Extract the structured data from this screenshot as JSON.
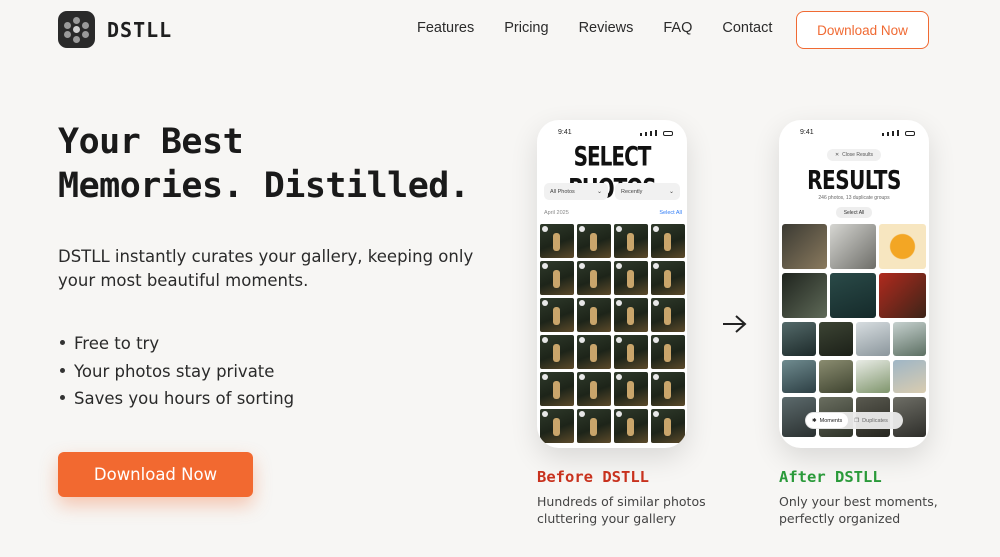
{
  "brand": {
    "name": "DSTLL"
  },
  "nav": {
    "links": [
      "Features",
      "Pricing",
      "Reviews",
      "FAQ",
      "Contact"
    ],
    "cta": "Download Now"
  },
  "hero": {
    "title_line1": "Your Best",
    "title_line2": "Memories. Distilled.",
    "description": "DSTLL instantly curates your gallery, keeping only your most beautiful moments.",
    "bullets": [
      "Free to try",
      "Your photos stay private",
      "Saves you hours of sorting"
    ],
    "cta": "Download Now"
  },
  "before_phone": {
    "time": "9:41",
    "title": "SELECT PHOTOS",
    "filter1": "All Photos",
    "filter2": "Recently",
    "section_date": "April 2025",
    "select_all": "Select All"
  },
  "after_phone": {
    "time": "9:41",
    "close_label": "Close Results",
    "title": "RESULTS",
    "subtitle": "246 photos, 13 duplicate groups",
    "select_all": "Select All",
    "tab_moments": "Moments",
    "tab_duplicates": "Duplicates"
  },
  "before_caption": {
    "title": "Before DSTLL",
    "desc": "Hundreds of similar photos cluttering your gallery",
    "color": "#c8321e"
  },
  "after_caption": {
    "title": "After DSTLL",
    "desc": "Only your best moments, perfectly organized",
    "color": "#2a9a3a"
  },
  "colors": {
    "accent": "#f26930",
    "dark": "#1b1b1b",
    "link_blue": "#2f7cf6"
  },
  "icons": {
    "arrow": "arrow-right-icon",
    "logo": "aperture-logo-icon"
  }
}
